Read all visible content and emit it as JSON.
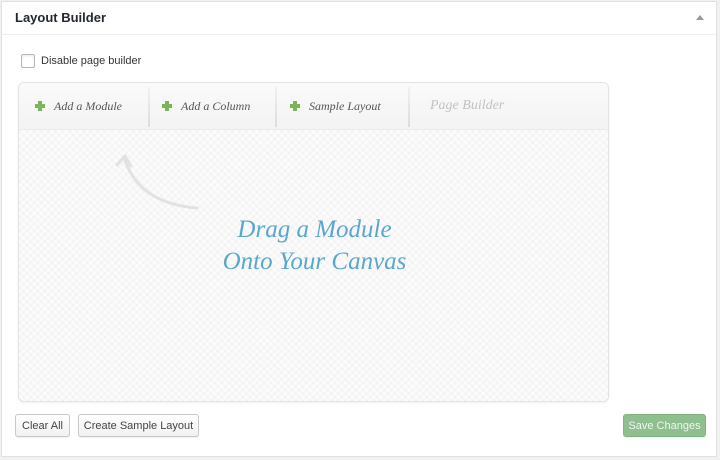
{
  "panel": {
    "title": "Layout Builder",
    "toggle_icon": "caret-up-icon"
  },
  "options": {
    "disable_label": "Disable page builder",
    "disable_checked": false
  },
  "toolbar": {
    "add_module": "Add a Module",
    "add_column": "Add a Column",
    "sample_layout": "Sample Layout",
    "page_builder": "Page Builder",
    "plus_icon": "plus-icon",
    "plus_color": "#7ab55a"
  },
  "canvas": {
    "line1": "Drag a Module",
    "line2": "Onto Your Canvas",
    "text_color": "#5aa7cc",
    "arrow_icon": "curved-arrow-icon"
  },
  "buttons": {
    "clear_all": "Clear All",
    "create_sample": "Create Sample Layout",
    "save": "Save Changes",
    "save_color": "#8fbf8f"
  }
}
